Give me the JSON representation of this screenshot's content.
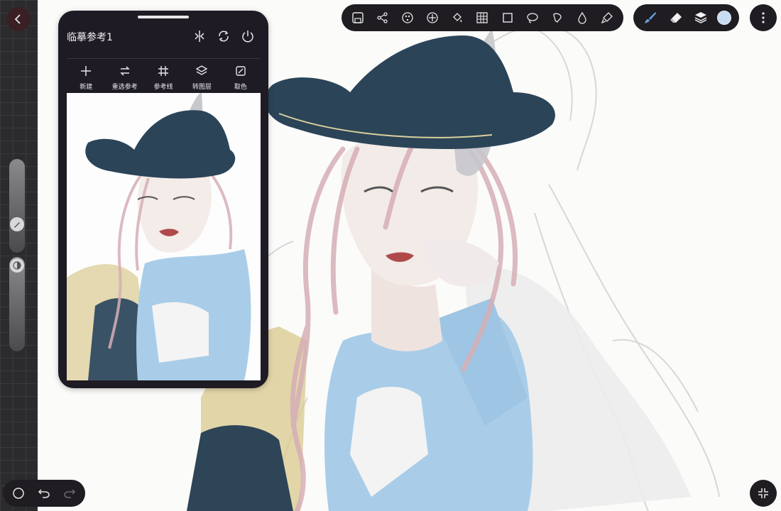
{
  "reference_panel": {
    "title": "临摹参考1",
    "tools": [
      {
        "icon": "plus-icon",
        "label": "新建"
      },
      {
        "icon": "swap-icon",
        "label": "重选参考"
      },
      {
        "icon": "grid-hash-icon",
        "label": "参考线"
      },
      {
        "icon": "layers-icon",
        "label": "转图层"
      },
      {
        "icon": "eyedropper-icon",
        "label": "取色"
      }
    ],
    "header_icons": [
      "flip-icon",
      "refresh-icon",
      "power-icon"
    ]
  },
  "toolbar": {
    "icons": [
      "save-icon",
      "share-icon",
      "adjust-icon",
      "transform-icon",
      "fill-icon",
      "grid-icon",
      "rect-select-icon",
      "lasso-icon",
      "shape-icon",
      "liquify-icon",
      "smudge-icon"
    ]
  },
  "brush_group": {
    "icons": [
      "brush-icon",
      "eraser-icon",
      "layers-icon"
    ],
    "current_color": "#c7dcf2"
  },
  "colors": {
    "panel_bg": "#1f1c22",
    "hat": "#2c4458",
    "jacket": "#a9cde8",
    "hair": "#d9b8bd",
    "ochre": "#d9c98e"
  }
}
